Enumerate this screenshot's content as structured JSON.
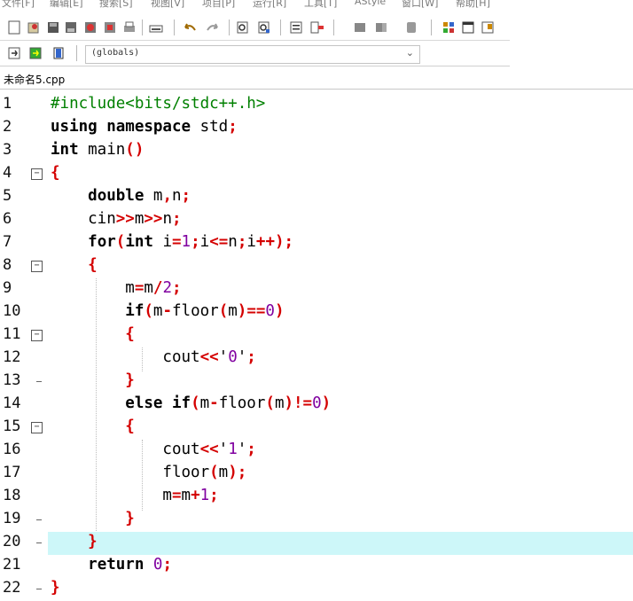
{
  "menu": [
    "文件[F]",
    "编辑[E]",
    "搜索[S]",
    "视图[V]",
    "项目[P]",
    "运行[R]",
    "工具[T]",
    "AStyle",
    "窗口[W]",
    "帮助[H]"
  ],
  "toolbar": {
    "scope_combo": "(globals)"
  },
  "tab": {
    "label": "未命名5.cpp"
  },
  "colors": {
    "highlight_line": "#cdf7f9",
    "operator": "#d40000",
    "number": "#8000a0",
    "preprocessor": "#008000"
  },
  "editor": {
    "current_line": 20,
    "lines": [
      {
        "n": "1",
        "text": "#include<bits/stdc++.h>"
      },
      {
        "n": "2",
        "text": "using namespace std;"
      },
      {
        "n": "3",
        "text": "int main()"
      },
      {
        "n": "4",
        "text": "{"
      },
      {
        "n": "5",
        "text": "    double m,n;"
      },
      {
        "n": "6",
        "text": "    cin>>m>>n;"
      },
      {
        "n": "7",
        "text": "    for(int i=1;i<=n;i++);"
      },
      {
        "n": "8",
        "text": "    {"
      },
      {
        "n": "9",
        "text": "        m=m/2;"
      },
      {
        "n": "10",
        "text": "        if(m-floor(m)==0)"
      },
      {
        "n": "11",
        "text": "        {"
      },
      {
        "n": "12",
        "text": "            cout<<'0';"
      },
      {
        "n": "13",
        "text": "        }"
      },
      {
        "n": "14",
        "text": "        else if(m-floor(m)!=0)"
      },
      {
        "n": "15",
        "text": "        {"
      },
      {
        "n": "16",
        "text": "            cout<<'1';"
      },
      {
        "n": "17",
        "text": "            floor(m);"
      },
      {
        "n": "18",
        "text": "            m=m+1;"
      },
      {
        "n": "19",
        "text": "        }"
      },
      {
        "n": "20",
        "text": "    }"
      },
      {
        "n": "21",
        "text": "    return 0;"
      },
      {
        "n": "22",
        "text": "}"
      }
    ]
  }
}
